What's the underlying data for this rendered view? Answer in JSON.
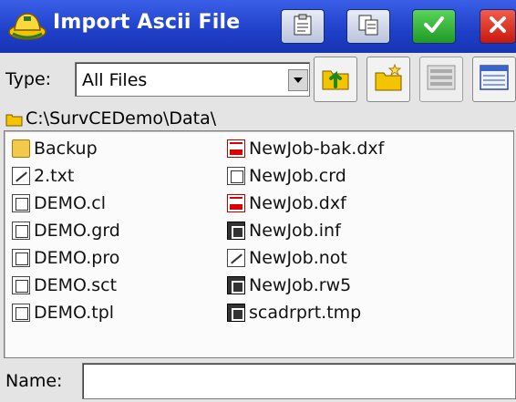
{
  "window": {
    "title": "Import Ascii File",
    "title_icon": "survey-hat-icon",
    "buttons": [
      {
        "name": "clipboard-icon"
      },
      {
        "name": "copy-icon"
      },
      {
        "name": "ok-check-icon"
      },
      {
        "name": "close-x-icon"
      }
    ]
  },
  "filter": {
    "label": "Type:",
    "selected": "All Files"
  },
  "toolbar": {
    "icons": [
      "folder-up-icon",
      "new-folder-icon",
      "details-view-icon",
      "list-view-icon"
    ]
  },
  "path": {
    "current": "C:\\SurvCEDemo\\Data\\"
  },
  "files": {
    "column1": [
      {
        "label": "Backup",
        "icon": "folder-icon"
      },
      {
        "label": "2.txt",
        "icon": "text-file-icon"
      },
      {
        "label": "DEMO.cl",
        "icon": "cl-file-icon"
      },
      {
        "label": "DEMO.grd",
        "icon": "grid-file-icon"
      },
      {
        "label": "DEMO.pro",
        "icon": "profile-file-icon"
      },
      {
        "label": "DEMO.sct",
        "icon": "section-file-icon"
      },
      {
        "label": "DEMO.tpl",
        "icon": "template-file-icon"
      }
    ],
    "column2": [
      {
        "label": "NewJob-bak.dxf",
        "icon": "dxf-file-icon"
      },
      {
        "label": "NewJob.crd",
        "icon": "crd-file-icon"
      },
      {
        "label": "NewJob.dxf",
        "icon": "dxf-file-icon"
      },
      {
        "label": "NewJob.inf",
        "icon": "inf-file-icon"
      },
      {
        "label": "NewJob.not",
        "icon": "note-file-icon"
      },
      {
        "label": "NewJob.rw5",
        "icon": "rw5-file-icon"
      },
      {
        "label": "scadrprt.tmp",
        "icon": "tmp-file-icon"
      }
    ]
  },
  "name_field": {
    "label": "Name:",
    "value": ""
  }
}
